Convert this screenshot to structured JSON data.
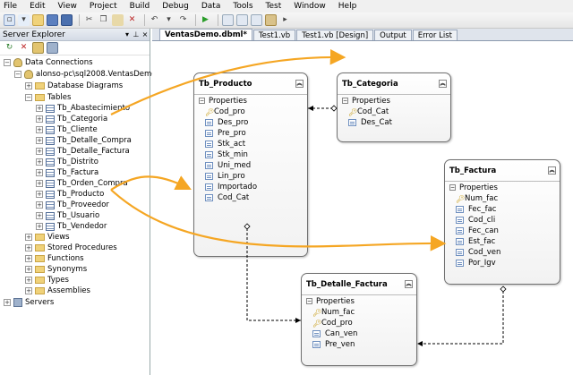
{
  "menu": [
    "File",
    "Edit",
    "View",
    "Project",
    "Build",
    "Debug",
    "Data",
    "Tools",
    "Test",
    "Window",
    "Help"
  ],
  "server_explorer": {
    "title": "Server Explorer",
    "data_connections": "Data Connections",
    "connection": "alonso-pc\\sql2008.VentasDemo.dbo",
    "database_diagrams": "Database Diagrams",
    "tables": "Tables",
    "table_items": [
      "Tb_Abastecimiento",
      "Tb_Categoria",
      "Tb_Cliente",
      "Tb_Detalle_Compra",
      "Tb_Detalle_Factura",
      "Tb_Distrito",
      "Tb_Factura",
      "Tb_Orden_Compra",
      "Tb_Producto",
      "Tb_Proveedor",
      "Tb_Usuario",
      "Tb_Vendedor"
    ],
    "folders": [
      "Views",
      "Stored Procedures",
      "Functions",
      "Synonyms",
      "Types",
      "Assemblies"
    ],
    "servers": "Servers"
  },
  "tabs": [
    "VentasDemo.dbml*",
    "Test1.vb",
    "Test1.vb [Design]",
    "Output",
    "Error List"
  ],
  "entities": {
    "producto": {
      "name": "Tb_Producto",
      "section": "Properties",
      "props": [
        "Cod_pro",
        "Des_pro",
        "Pre_pro",
        "Stk_act",
        "Stk_min",
        "Uni_med",
        "Lin_pro",
        "Importado",
        "Cod_Cat"
      ]
    },
    "categoria": {
      "name": "Tb_Categoria",
      "section": "Properties",
      "props": [
        "Cod_Cat",
        "Des_Cat"
      ]
    },
    "factura": {
      "name": "Tb_Factura",
      "section": "Properties",
      "props": [
        "Num_fac",
        "Fec_fac",
        "Cod_cli",
        "Fec_can",
        "Est_fac",
        "Cod_ven",
        "Por_Igv"
      ]
    },
    "detalle": {
      "name": "Tb_Detalle_Factura",
      "section": "Properties",
      "props": [
        "Num_fac",
        "Cod_pro",
        "Can_ven",
        "Pre_ven"
      ]
    }
  },
  "colors": {
    "arrow": "#f5a623",
    "tab_bar": "#dfe4ec",
    "panel_title": "#d4dbe6"
  }
}
